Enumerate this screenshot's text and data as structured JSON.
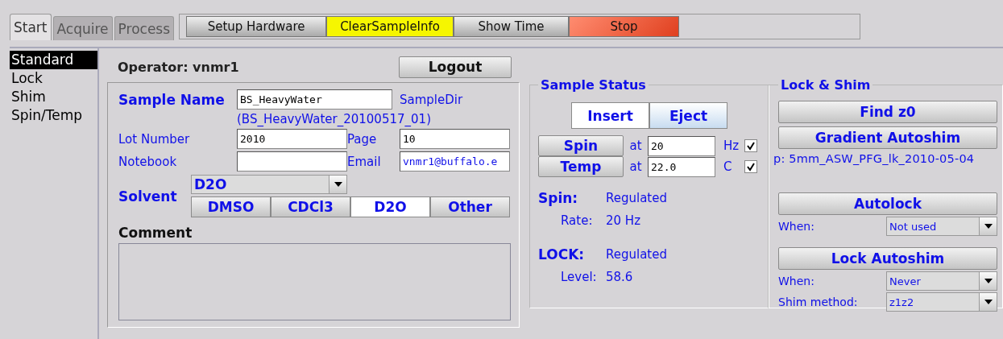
{
  "tabs": [
    {
      "label": "Start",
      "selected": true
    },
    {
      "label": "Acquire",
      "selected": false
    },
    {
      "label": "Process",
      "selected": false
    }
  ],
  "toolbar": [
    {
      "label": "Setup Hardware",
      "kind": "plain"
    },
    {
      "label": "ClearSampleInfo",
      "kind": "caution"
    },
    {
      "label": "Show Time",
      "kind": "plain"
    },
    {
      "label": "Stop",
      "kind": "danger"
    }
  ],
  "sidebar": {
    "items": [
      {
        "label": "Standard",
        "selected": true
      },
      {
        "label": "Lock",
        "selected": false
      },
      {
        "label": "Shim",
        "selected": false
      },
      {
        "label": "Spin/Temp",
        "selected": false
      }
    ]
  },
  "operator": {
    "label": "Operator: vnmr1",
    "button": "Logout"
  },
  "sample": {
    "name_label": "Sample Name",
    "name_value": "BS_HeavyWater",
    "dir_label": "SampleDir",
    "dir_value": "(BS_HeavyWater_20100517_01)",
    "lot_label": "Lot Number",
    "lot_value": "2010",
    "page_label": "Page",
    "page_value": "10",
    "notebook_label": "Notebook",
    "email_label": "Email",
    "email_value": "vnmr1@buffalo.e",
    "solvent": {
      "label": "Solvent",
      "value": "D2O",
      "buttons": [
        {
          "label": "DMSO",
          "selected": false
        },
        {
          "label": "CDCl3",
          "selected": false
        },
        {
          "label": "D2O",
          "selected": true
        },
        {
          "label": "Other",
          "selected": false
        }
      ]
    },
    "comment_label": "Comment"
  },
  "sample_status": {
    "title": "Sample Status",
    "buttons": [
      {
        "label": "Insert",
        "selected": true
      },
      {
        "label": "Eject",
        "selected": false
      }
    ],
    "controls": [
      {
        "button": "Spin",
        "at": "at",
        "value": "20",
        "unit": "Hz",
        "checked": true
      },
      {
        "button": "Temp",
        "at": "at",
        "value": "22.0",
        "unit": "C",
        "checked": true
      }
    ],
    "readouts": [
      {
        "kind": "head",
        "label": "Spin:",
        "value": "Regulated"
      },
      {
        "kind": "sub",
        "label": "Rate:",
        "value": "20 Hz"
      },
      {
        "kind": "head",
        "label": "LOCK:",
        "value": "Regulated"
      },
      {
        "kind": "sub",
        "label": "Level:",
        "value": "58.6"
      }
    ]
  },
  "lock_shim": {
    "title": "Lock & Shim",
    "find_button": "Find z0",
    "gradient_button": "Gradient Autoshim",
    "profile": "p: 5mm_ASW_PFG_lk_2010-05-04",
    "autolock_button": "Autolock",
    "autolock_when_label": "When:",
    "autolock_when": "Not used",
    "lockshim_button": "Lock Autoshim",
    "lockshim_when_label": "When:",
    "lockshim_when": "Never",
    "method_label": "Shim method:",
    "method": "z1z2"
  }
}
